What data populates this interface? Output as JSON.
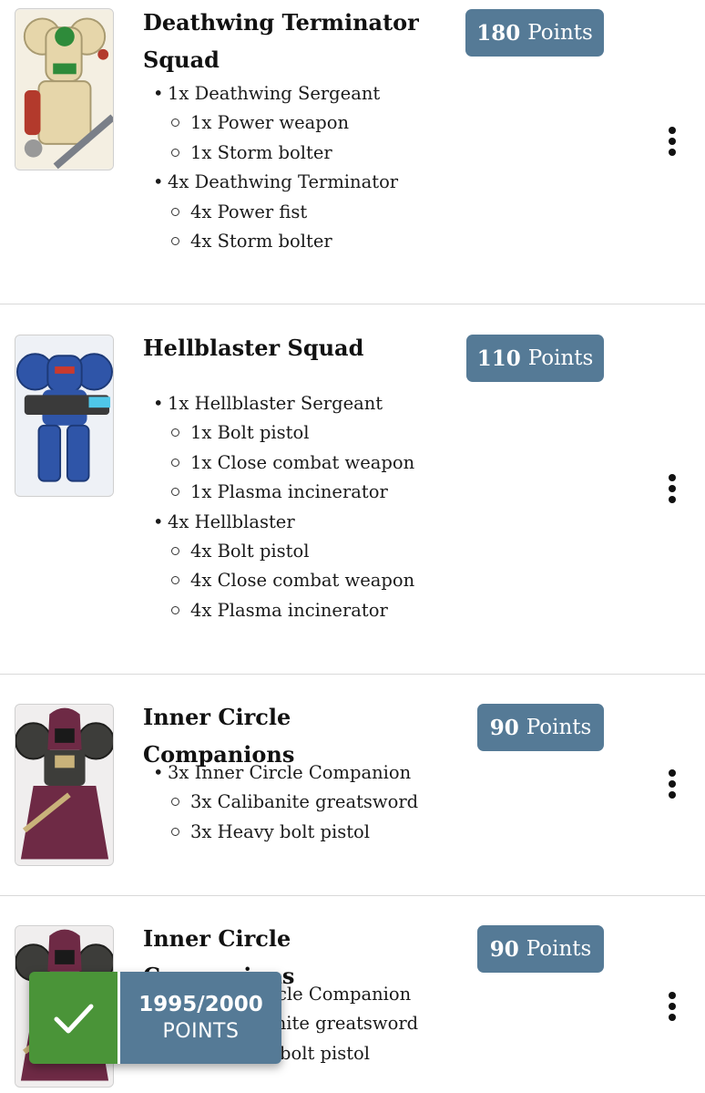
{
  "units": [
    {
      "title": "Deathwing Terminator Squad",
      "points": "180",
      "points_label": "Points",
      "thumb_icon": "deathwing-terminator-miniature",
      "colors": {
        "armor": "#e6d6aa",
        "accent": "#2e8b3a",
        "trim": "#b33a2c"
      },
      "groups": [
        {
          "label": "1x Deathwing Sergeant",
          "items": [
            "1x Power weapon",
            "1x Storm bolter"
          ]
        },
        {
          "label": "4x Deathwing Terminator",
          "items": [
            "4x Power fist",
            "4x Storm bolter"
          ]
        }
      ]
    },
    {
      "title": "Hellblaster Squad",
      "points": "110",
      "points_label": "Points",
      "thumb_icon": "hellblaster-miniature",
      "colors": {
        "armor": "#2f55a8",
        "accent": "#4fc7e8",
        "trim": "#3a3a3a"
      },
      "groups": [
        {
          "label": "1x Hellblaster Sergeant",
          "items": [
            "1x Bolt pistol",
            "1x Close combat weapon",
            "1x Plasma incinerator"
          ]
        },
        {
          "label": "4x Hellblaster",
          "items": [
            "4x Bolt pistol",
            "4x Close combat weapon",
            "4x Plasma incinerator"
          ]
        }
      ]
    },
    {
      "title": "Inner Circle Companions",
      "points": "90",
      "points_label": "Points",
      "thumb_icon": "inner-circle-companion-miniature",
      "colors": {
        "armor": "#3d3d3a",
        "accent": "#6e2a45",
        "trim": "#c9b27a"
      },
      "groups": [
        {
          "label": "3x Inner Circle Companion",
          "items": [
            "3x Calibanite greatsword",
            "3x Heavy bolt pistol"
          ]
        }
      ]
    },
    {
      "title": "Inner Circle Companions",
      "points": "90",
      "points_label": "Points",
      "thumb_icon": "inner-circle-companion-miniature",
      "colors": {
        "armor": "#3d3d3a",
        "accent": "#6e2a45",
        "trim": "#c9b27a"
      },
      "groups": [
        {
          "label": "3x Inner Circle Companion",
          "items": [
            "3x Calibanite greatsword",
            "3x Heavy bolt pistol"
          ]
        }
      ]
    }
  ],
  "toast": {
    "total": "1995/2000",
    "unit": "POINTS",
    "icon": "checkmark-icon",
    "colors": {
      "success": "#4a9438",
      "panel": "#557a96"
    }
  },
  "colors": {
    "badge": "#557a96",
    "divider": "#d9d9d9",
    "text": "#1a1a1a"
  }
}
